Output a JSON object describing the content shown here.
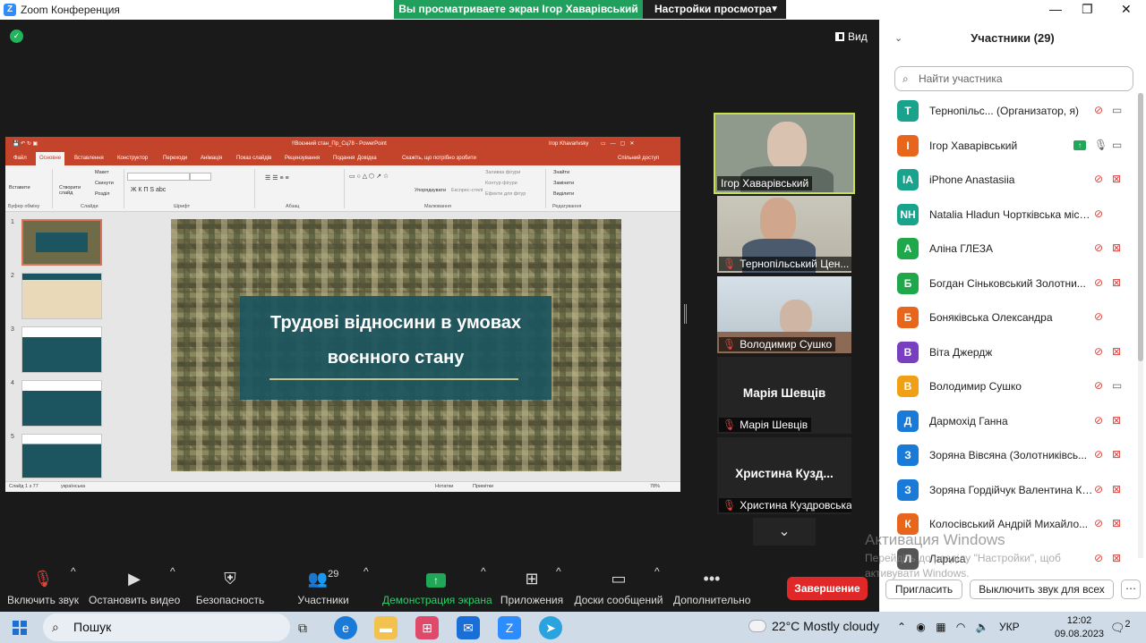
{
  "window": {
    "title": "Zoom Конференция",
    "logo_letter": "Z"
  },
  "share_banner": {
    "text": "Вы просматриваете экран Ігор Хаварівський",
    "view_settings": "Настройки просмотра"
  },
  "view_button": "Вид",
  "powerpoint": {
    "title": "!!Воєнний стан_Пр_Сц78 - PowerPoint",
    "user": "Ігор Khavarivsky",
    "tabs": [
      "Файл",
      "Основне",
      "Вставлення",
      "Конструктор",
      "Переходи",
      "Анімація",
      "Показ слайдів",
      "Рецензування",
      "Подання",
      "Довідка",
      "Скажіть, що потрібно зробити"
    ],
    "shared_access": "Спільний доступ",
    "ribbon": {
      "insert": "Вставити",
      "create_slide": "Створити слайд",
      "layout": "Макет",
      "reset": "Скинути",
      "section": "Розділ",
      "arrange": "Упорядкувати",
      "quick_styles": "Експрес-стилі",
      "shape_fill": "Заливка фігури",
      "shape_outline": "Контур фігури",
      "shape_effects": "Ефекти для фігур",
      "find": "Знайти",
      "replace": "Замінити",
      "select": "Виділити",
      "groups": [
        "Буфер обміну",
        "Слайди",
        "Шрифт",
        "Абзац",
        "Малювання",
        "Редагування"
      ]
    },
    "slide_numbers": [
      "1",
      "2",
      "3",
      "4",
      "5"
    ],
    "slide": {
      "title_line1": "Трудові відносини в умовах",
      "title_line2": "воєнного стану"
    },
    "status": {
      "slide_of": "Слайд 1 з 77",
      "language": "українська",
      "notes": "Нотатки",
      "comments": "Примітки",
      "zoom": "78%"
    }
  },
  "video_tiles": [
    {
      "name": "Ігор Хаварівський",
      "muted": false
    },
    {
      "name": "Тернопільський Цен...",
      "muted": true
    },
    {
      "name": "Володимир Сушко",
      "muted": true
    },
    {
      "name": "Марія Шевців",
      "big_name": "Марія Шевців",
      "muted": true
    },
    {
      "name": "Христина Куздровська",
      "big_name": "Христина  Кузд...",
      "muted": true
    }
  ],
  "toolbar": [
    {
      "label": "Включить звук",
      "icon": "mic-muted-icon"
    },
    {
      "label": "Остановить видео",
      "icon": "video-camera-icon"
    },
    {
      "label": "Безопасность",
      "icon": "shield-icon"
    },
    {
      "label": "Участники",
      "icon": "participants-icon",
      "count": "29"
    },
    {
      "label": "Демонстрация экрана",
      "icon": "share-screen-icon"
    },
    {
      "label": "Приложения",
      "icon": "apps-icon"
    },
    {
      "label": "Доски сообщений",
      "icon": "whiteboard-icon"
    },
    {
      "label": "Дополнительно",
      "icon": "more-icon"
    }
  ],
  "end_button": "Завершение",
  "participants_panel": {
    "title": "Участники (29)",
    "search_placeholder": "Найти участника",
    "participants": [
      {
        "initials": "T",
        "name": "Тернопільс...  (Организатор, я)",
        "color": "#1aa38c",
        "mic": "muted",
        "cam": "on"
      },
      {
        "initials": "I",
        "name": "Ігор Хаварівський",
        "color": "#e8661c",
        "mic": "on",
        "cam": "on",
        "sharing": true
      },
      {
        "initials": "IA",
        "name": "iPhone Anastasiia",
        "color": "#1aa38c",
        "mic": "muted",
        "cam": "off"
      },
      {
        "initials": "NH",
        "name": "Natalia Hladun Чортківська міська ...",
        "color": "#1aa38c",
        "mic": "muted",
        "cam": "none"
      },
      {
        "initials": "А",
        "name": "Аліна ГЛЕЗА",
        "color": "#1fa84a",
        "mic": "muted",
        "cam": "off"
      },
      {
        "initials": "Б",
        "name": "Богдан Сіньковський Золотни...",
        "color": "#1fa84a",
        "mic": "muted",
        "cam": "off"
      },
      {
        "initials": "Б",
        "name": "Боняківська Олександра",
        "color": "#e8661c",
        "mic": "muted",
        "cam": "none"
      },
      {
        "initials": "В",
        "name": "Віта Джердж",
        "color": "#7a3fc0",
        "mic": "muted",
        "cam": "off"
      },
      {
        "initials": "В",
        "name": "Володимир Сушко",
        "color": "#f0a014",
        "mic": "muted",
        "cam": "on"
      },
      {
        "initials": "Д",
        "name": "Дармохід Ганна",
        "color": "#1a7ad8",
        "mic": "muted",
        "cam": "off"
      },
      {
        "initials": "З",
        "name": "Зоряна Вівсяна (Золотниківсь...",
        "color": "#1a7ad8",
        "mic": "muted",
        "cam": "off"
      },
      {
        "initials": "З",
        "name": "Зоряна Гордійчук Валентина Кури...",
        "color": "#1a7ad8",
        "mic": "muted",
        "cam": "off"
      },
      {
        "initials": "К",
        "name": "Колосівський Андрій Михайло...",
        "color": "#e8661c",
        "mic": "muted",
        "cam": "off"
      },
      {
        "initials": "Л",
        "name": "Лариса",
        "color": "#555",
        "mic": "muted",
        "cam": "off"
      }
    ],
    "invite": "Пригласить",
    "mute_all": "Выключить звук для всех"
  },
  "watermark": {
    "line1": "Активация Windows",
    "line2": "Перейдіть до розділу \"Настройки\", щоб",
    "line3": "активувати Windows."
  },
  "taskbar": {
    "search": "Пошук",
    "weather": "22°C  Mostly cloudy",
    "lang": "УКР",
    "time": "12:02",
    "date": "09.08.2023",
    "notif_count": "2"
  }
}
